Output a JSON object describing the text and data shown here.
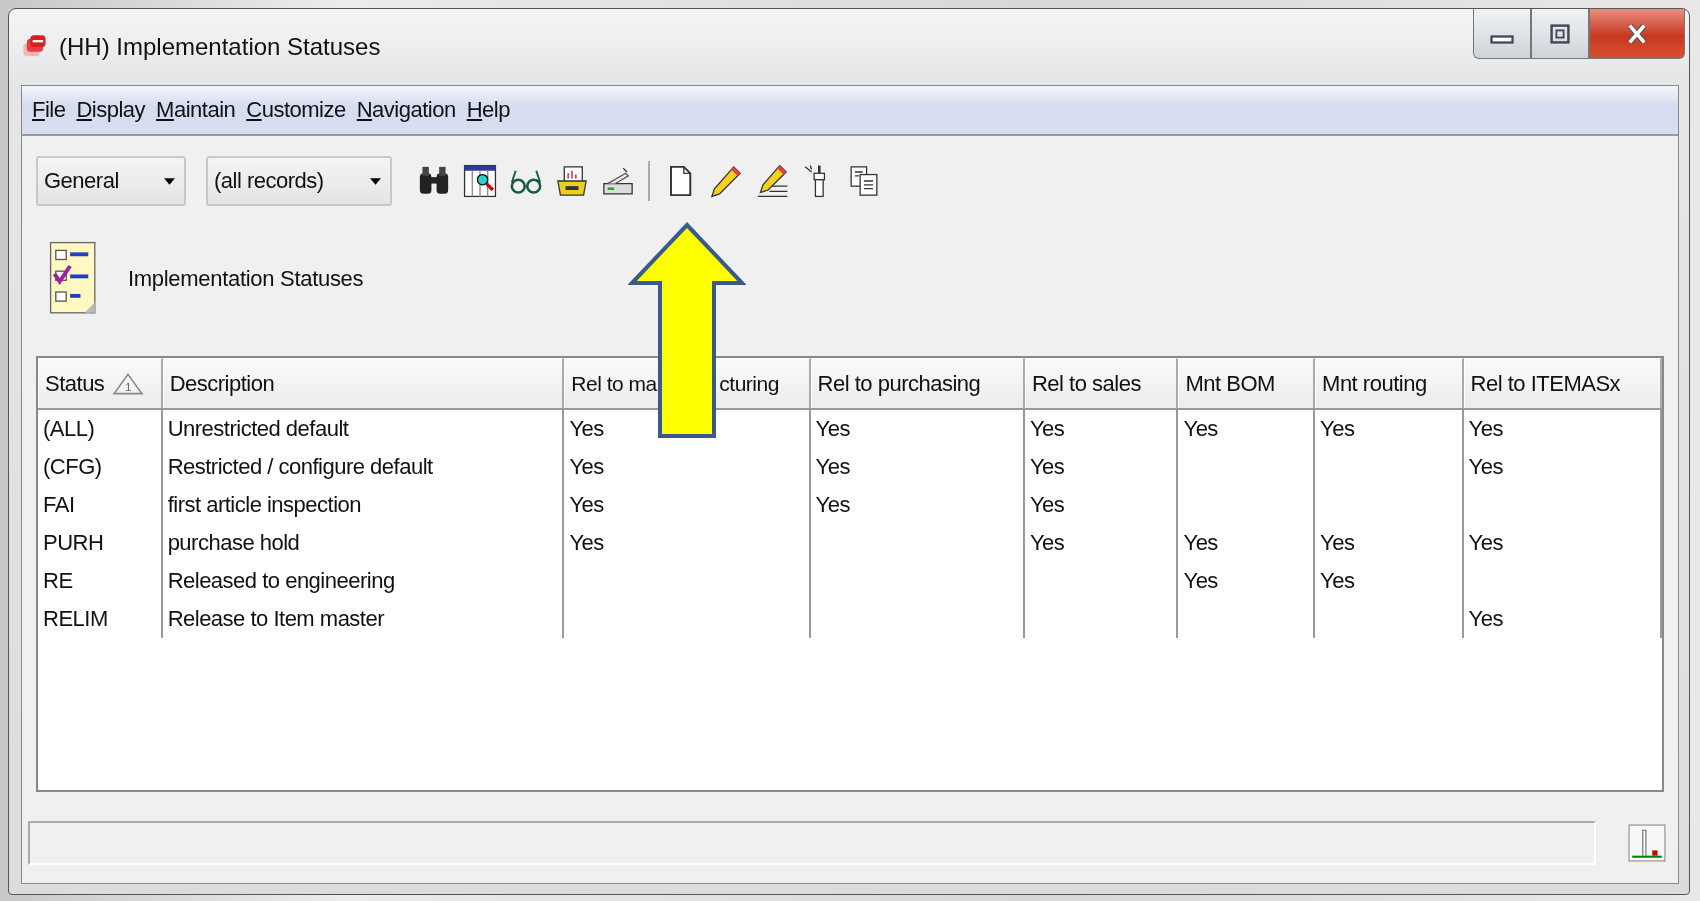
{
  "window": {
    "title": "(HH) Implementation Statuses"
  },
  "menu": [
    {
      "accel": "F",
      "rest": "ile"
    },
    {
      "accel": "D",
      "rest": "isplay"
    },
    {
      "accel": "M",
      "rest": "aintain"
    },
    {
      "accel": "C",
      "rest": "ustomize"
    },
    {
      "accel": "N",
      "rest": "avigation"
    },
    {
      "accel": "H",
      "rest": "elp"
    }
  ],
  "toolbar": {
    "dropdowns": [
      {
        "value": "General"
      },
      {
        "value": "(all records)"
      }
    ]
  },
  "heading": "Implementation Statuses",
  "table": {
    "columns": [
      {
        "label": "Status",
        "sort_order": "1"
      },
      {
        "label": "Description"
      },
      {
        "label_parts": [
          "Rel to ma",
          "cturing"
        ]
      },
      {
        "label": "Rel to purchasing"
      },
      {
        "label": "Rel to sales"
      },
      {
        "label": "Mnt BOM"
      },
      {
        "label": "Mnt routing"
      },
      {
        "label": "Rel to ITEMASx"
      }
    ],
    "rows": [
      {
        "cells": [
          "(ALL)",
          "Unrestricted default",
          "Yes",
          "Yes",
          "Yes",
          "Yes",
          "Yes",
          "Yes"
        ]
      },
      {
        "cells": [
          "(CFG)",
          "Restricted / configure default",
          "Yes",
          "Yes",
          "Yes",
          null,
          null,
          "Yes"
        ]
      },
      {
        "cells": [
          "FAI",
          "first article inspection",
          "Yes",
          "Yes",
          "Yes",
          null,
          null,
          null
        ]
      },
      {
        "cells": [
          "PURH",
          "purchase hold",
          "Yes",
          null,
          "Yes",
          "Yes",
          "Yes",
          "Yes"
        ]
      },
      {
        "cells": [
          "RE",
          "Released to engineering",
          null,
          null,
          null,
          "Yes",
          "Yes",
          null
        ]
      },
      {
        "cells": [
          "RELIM",
          "Release to Item master",
          null,
          null,
          null,
          null,
          null,
          "Yes"
        ]
      }
    ]
  }
}
